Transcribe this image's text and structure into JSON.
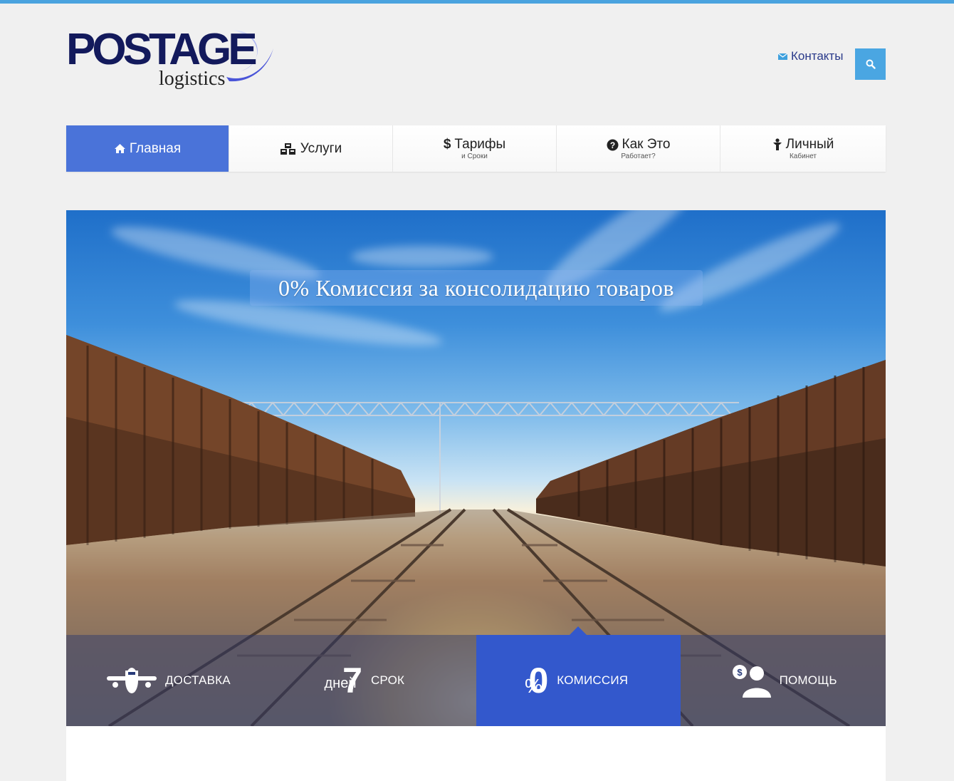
{
  "header": {
    "logo_main": "POSTAGE",
    "logo_sub": "logistics",
    "contacts_label": "Контакты"
  },
  "nav": {
    "items": [
      {
        "label": "Главная",
        "sub": "",
        "icon": "home-icon"
      },
      {
        "label": "Услуги",
        "sub": "",
        "icon": "boxes-icon"
      },
      {
        "label": "Тарифы",
        "sub": "и Сроки",
        "icon": "dollar-icon"
      },
      {
        "label": "Как Это",
        "sub": "Работает?",
        "icon": "question-circle-icon"
      },
      {
        "label": "Личный",
        "sub": "Кабинет",
        "icon": "person-icon"
      }
    ]
  },
  "hero": {
    "banner": "0% Комиссия за консолидацию товаров"
  },
  "features": [
    {
      "label": "ДОСТАВКА",
      "icon": "airplane-icon"
    },
    {
      "label": "СРОК",
      "icon": "seven-days-icon",
      "big": "7",
      "overlay": "дней"
    },
    {
      "label": "КОМИССИЯ",
      "icon": "zero-percent-icon",
      "big": "0",
      "overlay": "%"
    },
    {
      "label": "ПОМОЩЬ",
      "icon": "support-person-icon"
    }
  ],
  "colors": {
    "accent": "#4a73d9",
    "top_border": "#4aa3df",
    "search_bg": "#4aa6e2",
    "feature_active": "#3358cc"
  }
}
